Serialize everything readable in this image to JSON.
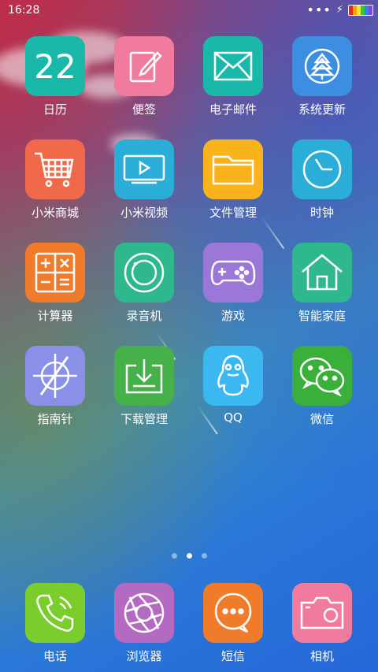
{
  "status": {
    "time": "16:28",
    "battery_colors": [
      "#e8232a",
      "#f3a21a",
      "#f7e71b",
      "#3fbf3f",
      "#2f86e6",
      "#7a4ae0"
    ]
  },
  "apps": [
    {
      "label": "日历",
      "icon": "calendar-icon",
      "day": "22",
      "color": "#19b8a8"
    },
    {
      "label": "便签",
      "icon": "notes-icon",
      "color": "#f07b9e"
    },
    {
      "label": "电子邮件",
      "icon": "mail-icon",
      "color": "#19b8a8"
    },
    {
      "label": "系统更新",
      "icon": "tree-icon",
      "color": "#3c8fe0"
    },
    {
      "label": "小米商城",
      "icon": "cart-icon",
      "color": "#f06a4a"
    },
    {
      "label": "小米视频",
      "icon": "video-icon",
      "color": "#2aaed8"
    },
    {
      "label": "文件管理",
      "icon": "folder-icon",
      "color": "#fbb31c"
    },
    {
      "label": "时钟",
      "icon": "clock-icon",
      "color": "#2aaed8"
    },
    {
      "label": "计算器",
      "icon": "calculator-icon",
      "color": "#f07b2a"
    },
    {
      "label": "录音机",
      "icon": "recorder-icon",
      "color": "#2fb78e"
    },
    {
      "label": "游戏",
      "icon": "gamepad-icon",
      "color": "#9b78d8"
    },
    {
      "label": "智能家庭",
      "icon": "home-icon",
      "color": "#2fb78e"
    },
    {
      "label": "指南针",
      "icon": "compass-icon",
      "color": "#8a8fe8"
    },
    {
      "label": "下载管理",
      "icon": "download-icon",
      "color": "#46b04a"
    },
    {
      "label": "QQ",
      "icon": "penguin-icon",
      "color": "#3cb8f0"
    },
    {
      "label": "微信",
      "icon": "wechat-icon",
      "color": "#3ab03a"
    }
  ],
  "dock": [
    {
      "label": "电话",
      "icon": "phone-icon",
      "color": "#7acd2a"
    },
    {
      "label": "浏览器",
      "icon": "browser-icon",
      "color": "#b56ac2"
    },
    {
      "label": "短信",
      "icon": "message-icon",
      "color": "#f07b2a"
    },
    {
      "label": "相机",
      "icon": "camera-icon",
      "color": "#f07b9e"
    }
  ],
  "pages": {
    "count": 3,
    "active": 2
  }
}
